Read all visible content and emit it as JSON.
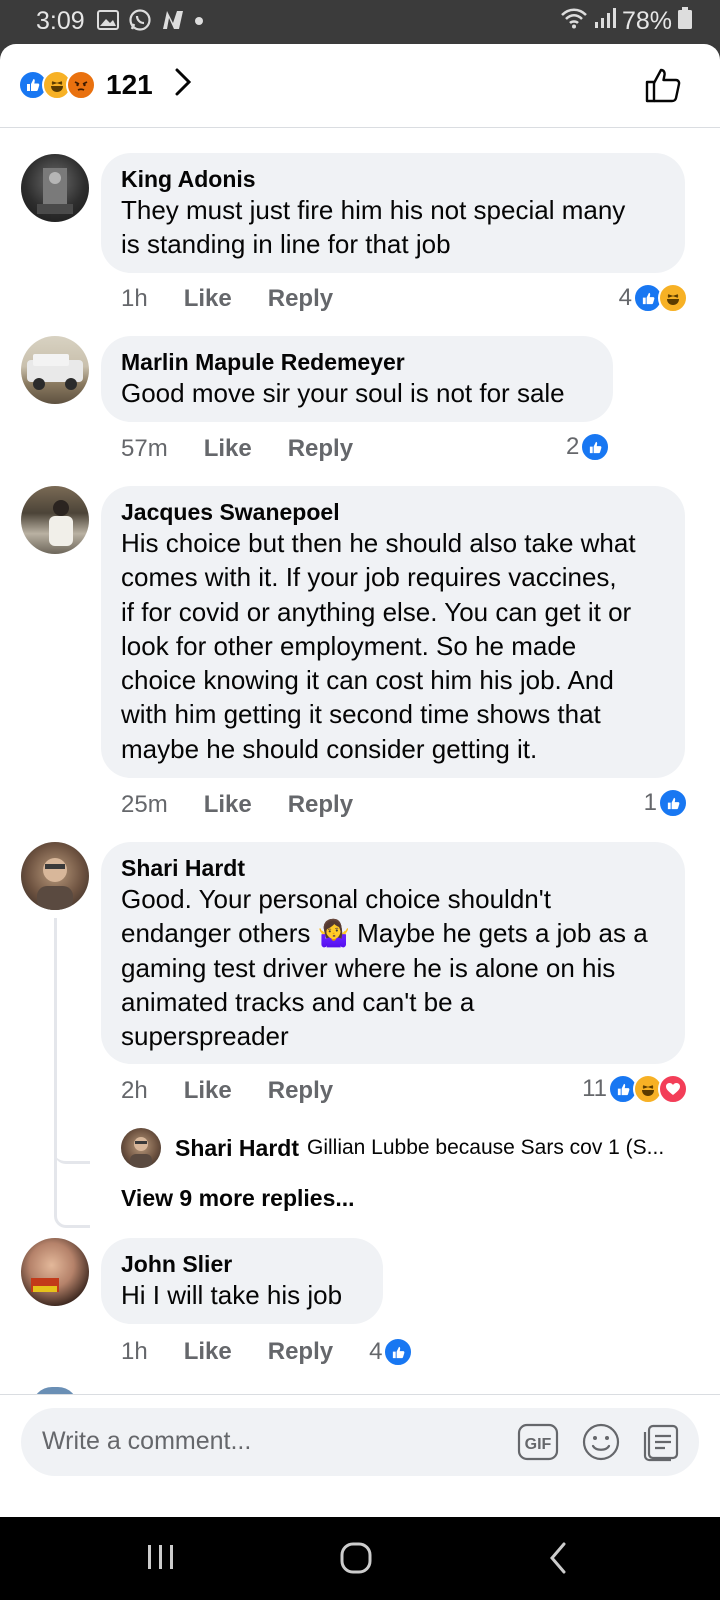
{
  "status_bar": {
    "time": "3:09",
    "battery": "78%",
    "icons": [
      "gallery-icon",
      "whatsapp-icon",
      "n-icon",
      "dot-icon",
      "wifi-icon",
      "signal-icon",
      "battery-icon"
    ]
  },
  "header": {
    "reactions": [
      "like",
      "haha",
      "angry"
    ],
    "reaction_count": "121"
  },
  "comments": [
    {
      "author": "King Adonis",
      "lines": [
        "They must just fire him his not special many",
        "is standing in line for that job"
      ],
      "time": "1h",
      "like": "Like",
      "reply": "Reply",
      "reaction_count": "4",
      "reactions": [
        "like",
        "haha"
      ]
    },
    {
      "author": "Marlin Mapule Redemeyer",
      "lines": [
        "Good move sir your soul is not for sale"
      ],
      "time": "57m",
      "like": "Like",
      "reply": "Reply",
      "reaction_count": "2",
      "reactions": [
        "like"
      ]
    },
    {
      "author": "Jacques Swanepoel",
      "lines": [
        "His choice but then he should also take what",
        "comes with it. If your job requires vaccines,",
        "if for covid or anything else. You can get it or",
        "look for other employment. So he made",
        "choice knowing it can cost him his job. And",
        "with him getting it second time shows that",
        "maybe he should consider getting it."
      ],
      "time": "25m",
      "like": "Like",
      "reply": "Reply",
      "reaction_count": "1",
      "reactions": [
        "like"
      ]
    },
    {
      "author": "Shari Hardt",
      "lines": [
        "Good. Your personal choice shouldn't",
        "endanger others 🤷‍♀️ Maybe he gets a job as a",
        "gaming test driver where he is alone on his",
        "animated tracks and can't be a",
        "superspreader"
      ],
      "time": "2h",
      "like": "Like",
      "reply": "Reply",
      "reaction_count": "11",
      "reactions": [
        "like",
        "haha",
        "love"
      ],
      "reply_preview": {
        "author": "Shari Hardt",
        "text": "Gillian Lubbe because Sars cov 1 (S..."
      },
      "view_more": "View 9 more replies..."
    },
    {
      "author": "John Slier",
      "lines": [
        "Hi I will take his job"
      ],
      "time": "1h",
      "like": "Like",
      "reply": "Reply",
      "reaction_count": "4",
      "reactions": [
        "like"
      ]
    }
  ],
  "composer": {
    "placeholder": "Write a comment...",
    "gif_label": "GIF"
  },
  "colors": {
    "like_blue": "#1877f2",
    "haha_yellow": "#f7b125",
    "angry_orange": "#e9710f",
    "love_red": "#f33e58",
    "bubble_gray": "#f0f2f5",
    "secondary_text": "#65676b"
  }
}
